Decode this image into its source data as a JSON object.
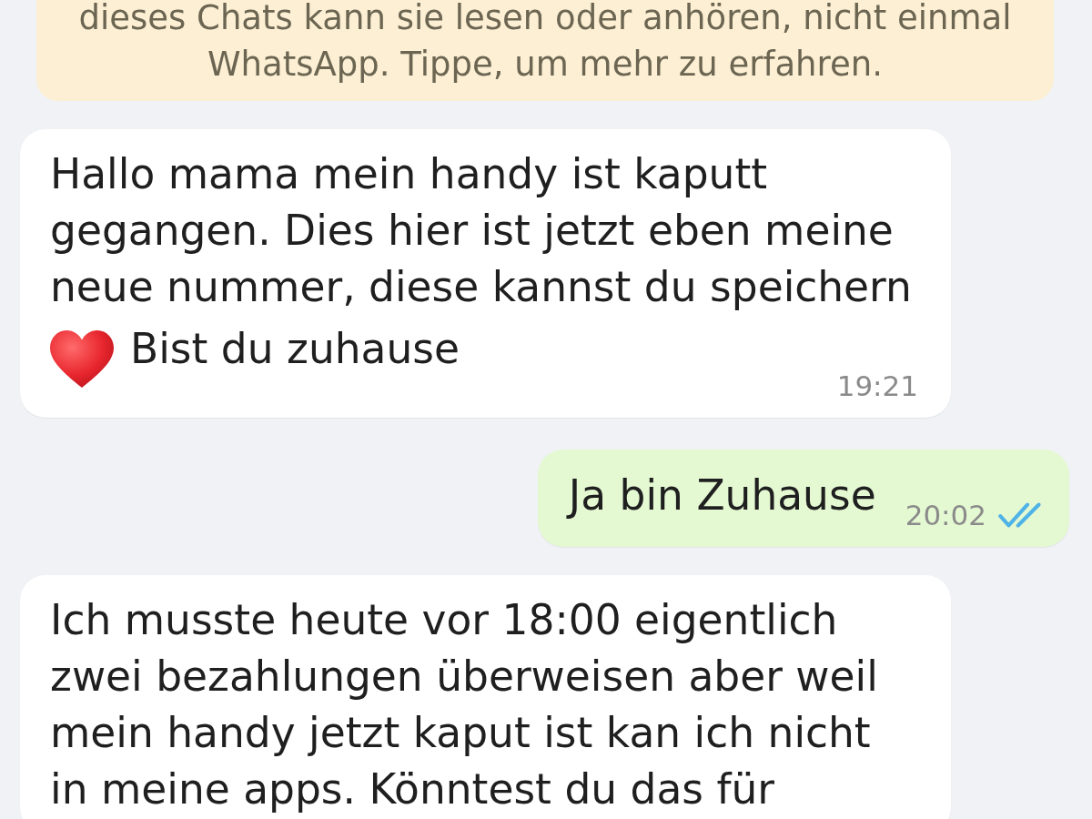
{
  "encryption_notice": {
    "text": "dieses Chats kann sie lesen oder anhören, nicht einmal WhatsApp. Tippe, um mehr zu erfahren."
  },
  "messages": [
    {
      "outgoing": false,
      "parts": [
        {
          "kind": "text",
          "text": "Hallo mama mein handy ist kaputt gegangen. Dies hier ist jetzt eben meine neue nummer, diese kannst du speichern"
        },
        {
          "kind": "emoji"
        },
        {
          "kind": "text",
          "text": "Bist du zuhause"
        }
      ],
      "time": "19:21"
    },
    {
      "outgoing": true,
      "parts": [
        {
          "kind": "text",
          "text": "Ja bin Zuhause"
        }
      ],
      "time": "20:02",
      "read": true
    },
    {
      "outgoing": false,
      "parts": [
        {
          "kind": "text",
          "text": "Ich musste heute vor 18:00 eigentlich zwei bezahlungen überweisen aber weil mein handy jetzt kaput ist kan ich nicht in meine apps. Könntest du das für"
        }
      ]
    }
  ]
}
